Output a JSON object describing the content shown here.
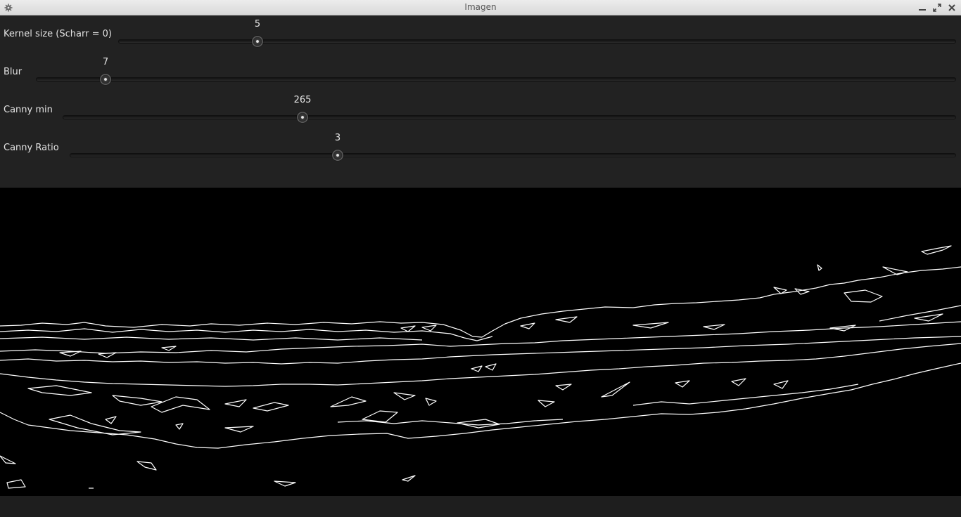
{
  "window": {
    "title": "Imagen",
    "icons": [
      "gear-icon",
      "minimize-icon",
      "maximize-icon",
      "close-icon"
    ]
  },
  "trackbars": [
    {
      "label": "Kernel size (Scharr = 0)",
      "value": "5"
    },
    {
      "label": "Blur",
      "value": "7"
    },
    {
      "label": "Canny min",
      "value": "265"
    },
    {
      "label": "Canny Ratio",
      "value": "3"
    }
  ],
  "colors": {
    "titlebar": "#e2e2e2",
    "panel": "#222222",
    "image_background": "#000000",
    "edges": "#ffffff"
  }
}
